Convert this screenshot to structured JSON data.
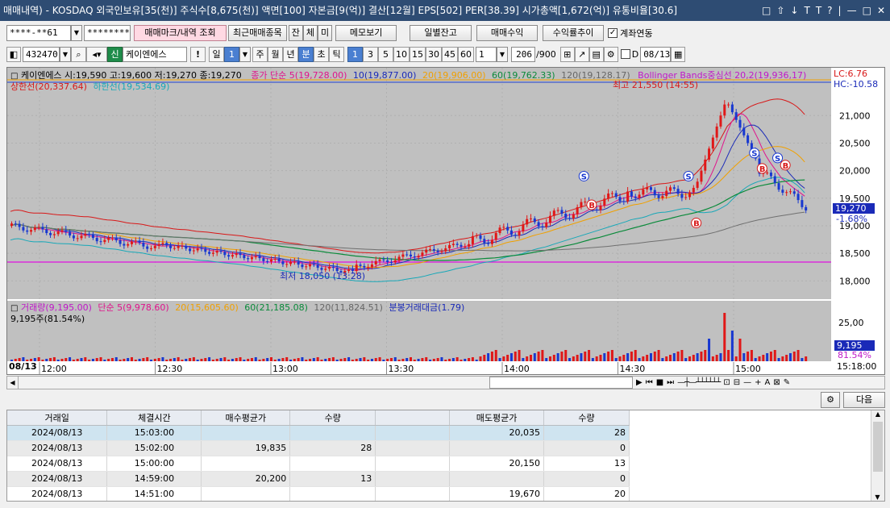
{
  "window": {
    "title": "매매내역) - KOSDAQ 외국인보유[35(천)] 주식수[8,675(천)] 액면[100] 자본금[9(억)] 결산[12월] EPS[502] PER[38.39] 시가총액[1,672(억)] 유통비율[30.6]",
    "icons": [
      "□",
      "⇧",
      "↓",
      "T",
      "T",
      "?",
      "|",
      "—",
      "□",
      "✕"
    ]
  },
  "toolbar1": {
    "account": "****-**61",
    "password": "********",
    "btn_trade_mark": "매매마크/내역 조회",
    "btn_recent": "최근매매종목",
    "btn_jan": "잔",
    "btn_che": "체",
    "btn_mi": "미",
    "btn_memo": "메모보기",
    "btn_daily": "일별잔고",
    "btn_profit": "매매수익",
    "btn_rate": "수익률추이",
    "link_label": "계좌연동"
  },
  "toolbar2": {
    "code": "432470",
    "shin": "신",
    "name": "케이엔에스",
    "excl": "!",
    "period_il": "일",
    "period_num": "1",
    "w": "주",
    "m": "월",
    "y": "년",
    "min": "분",
    "cho": "초",
    "tick": "틱",
    "intervals": [
      "1",
      "3",
      "5",
      "10",
      "15",
      "30",
      "45",
      "60"
    ],
    "count": "1",
    "range": "206",
    "range_total": "/900",
    "date": "08/13"
  },
  "chart": {
    "price_info": "케이엔에스 시:19,590 고:19,600 저:19,270 종:19,270",
    "ma_title": "종가 단순",
    "ma5": "5(19,728.00)",
    "ma10": "10(19,877.00)",
    "ma20": "20(19,906.00)",
    "ma60": "60(19,762.33)",
    "ma120": "120(19,128.17)",
    "bb": "Bollinger Bands중심선 20,2(19,936,17)",
    "upper_limit": "상한선(20,337.64)",
    "lower_limit": "하한선(19,534.69)",
    "high_note": "최고 21,550 (14:55)",
    "low_note": "최저 18,050 (13:28)",
    "lc": "LC:6.76",
    "hc": "HC:-10.58",
    "price_ticks": [
      "21,000",
      "20,500",
      "20,000",
      "19,500",
      "19,000",
      "18,500",
      "18,000"
    ],
    "cur_price": "19,270",
    "cur_change": "-1.68%",
    "time_ticks": [
      "12:00",
      "12:30",
      "13:00",
      "13:30",
      "14:00",
      "14:30",
      "15:00"
    ],
    "date_label": "08/13",
    "clock": "15:18:00",
    "vol_title": "거래량(9,195.00)",
    "vol_ma_title": "단순",
    "vol_ma5": "5(9,978.60)",
    "vol_ma20": "20(15,605.60)",
    "vol_ma60": "60(21,185.08)",
    "vol_ma120": "120(11,824.51)",
    "vol_amount": "분봉거래대금(1.79)",
    "vol_shares": "9,195주(81.54%)",
    "vol_tick": "25,00",
    "vol_cur": "9,195",
    "vol_pct": "81.54%"
  },
  "bottom": {
    "next": "다음"
  },
  "table": {
    "headers": [
      "거래일",
      "체결시간",
      "매수평균가",
      "수량",
      "",
      "매도평균가",
      "수량"
    ],
    "rows": [
      [
        "2024/08/13",
        "15:03:00",
        "",
        "",
        "",
        "20,035",
        "28"
      ],
      [
        "2024/08/13",
        "15:02:00",
        "19,835",
        "28",
        "",
        "",
        "0"
      ],
      [
        "2024/08/13",
        "15:00:00",
        "",
        "",
        "",
        "20,150",
        "13"
      ],
      [
        "2024/08/13",
        "14:59:00",
        "20,200",
        "13",
        "",
        "",
        "0"
      ],
      [
        "2024/08/13",
        "14:51:00",
        "",
        "",
        "",
        "19,670",
        "20"
      ]
    ]
  }
}
